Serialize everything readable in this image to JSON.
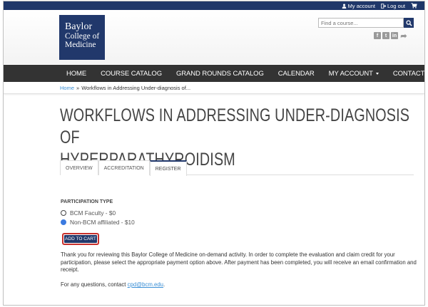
{
  "topbar": {
    "my_account": "My account",
    "log_out": "Log out",
    "cart_icon": "cart-icon"
  },
  "logo": {
    "line1": "Baylor",
    "line2": "College of",
    "line3": "Medicine"
  },
  "search": {
    "placeholder": "Find a course..."
  },
  "social": [
    "f",
    "t",
    "in",
    "share"
  ],
  "nav": {
    "items": [
      "HOME",
      "COURSE CATALOG",
      "GRAND ROUNDS CATALOG",
      "CALENDAR",
      "MY ACCOUNT",
      "CONTACT US"
    ]
  },
  "breadcrumb": {
    "home": "Home",
    "separator": "»",
    "current": "Workflows in Addressing Under-diagnosis of..."
  },
  "page": {
    "title_line1": "WORKFLOWS IN ADDRESSING UNDER-DIAGNOSIS OF",
    "title_line2": "HYPERPARATHYROIDISM"
  },
  "tabs": [
    "OVERVIEW",
    "ACCREDITATION",
    "REGISTER"
  ],
  "registration": {
    "participation_label": "PARTICIPATION TYPE",
    "options": [
      "BCM Faculty - $0",
      "Non-BCM affiliated - $10"
    ],
    "selected_index": 1,
    "add_to_cart": "ADD TO CART",
    "paragraph": "Thank you for reviewing this Baylor College of Medicine on-demand activity. In order to complete the evaluation and claim credit for your participation, please select the appropriate payment option above. After payment has been completed, you will receive an email confirmation and receipt.",
    "contact_prefix": "For any questions, contact ",
    "contact_email": "cpd@bcm.edu",
    "contact_suffix": "."
  },
  "colors": {
    "brand_navy": "#21386b",
    "nav_bg": "#333333",
    "link_blue": "#3a8fd6",
    "cart_outline": "#c8302c",
    "radio_selected": "#3b7be0"
  }
}
